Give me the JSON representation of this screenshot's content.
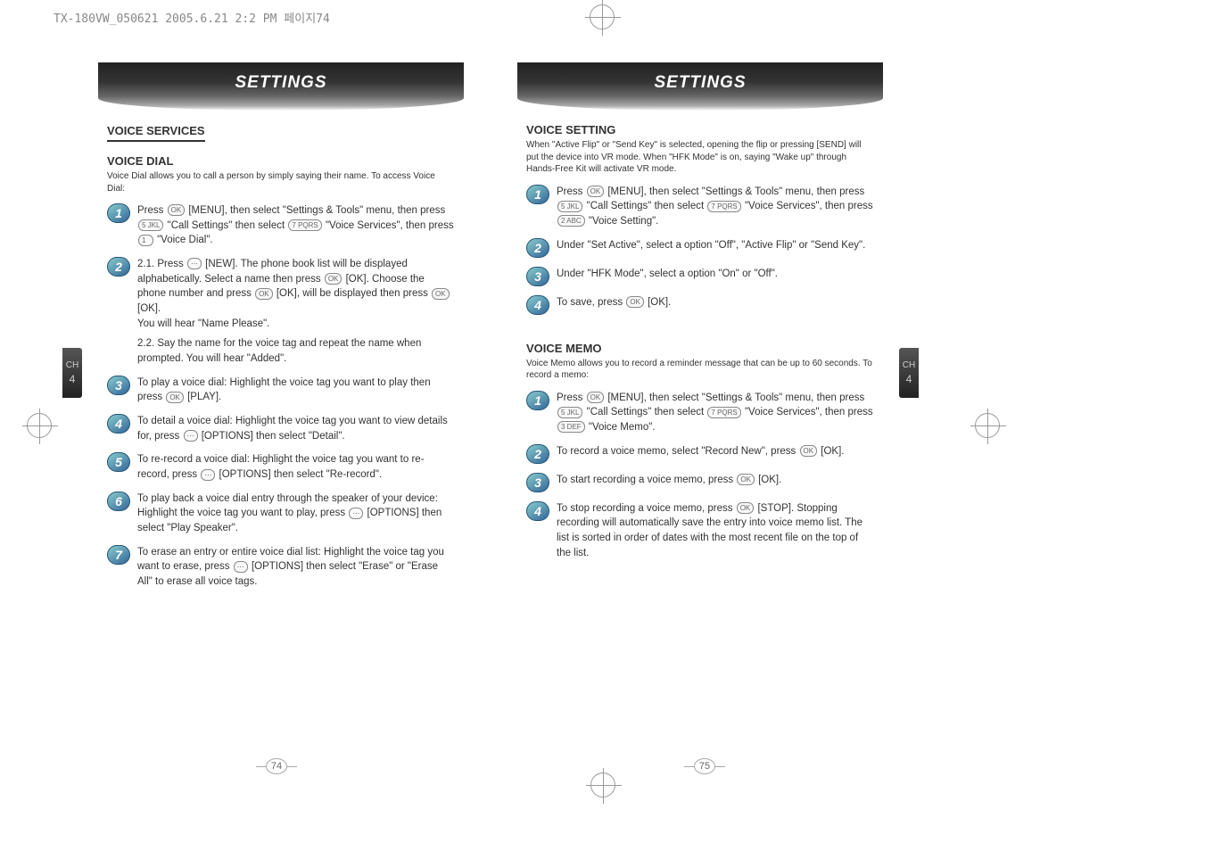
{
  "print_header": "TX-180VW_050621  2005.6.21 2:2 PM  페이지74",
  "left": {
    "banner": "SETTINGS",
    "section": "VOICE SERVICES",
    "sub": "VOICE DIAL",
    "intro": "Voice Dial allows you to call a person by simply saying their name. To access Voice Dial:",
    "steps": [
      {
        "n": "1",
        "text": "Press [OK] [MENU], then select \"Settings & Tools\" menu, then press [5] \"Call Settings\" then select [7] \"Voice Services\", then press [1] \"Voice Dial\"."
      },
      {
        "n": "2",
        "text": "2.1. Press [NEW]. The phone book list will be displayed alphabetically. Select a name then press [OK] [OK]. Choose the phone number and press [OK] [OK], will be displayed then press [OK] [OK].\nYou will hear \"Name Please\".\n2.2. Say the name for the voice tag and repeat the name when prompted. You will hear \"Added\"."
      },
      {
        "n": "3",
        "text": "To play a voice dial: Highlight the voice tag you want to play then press [OK] [PLAY]."
      },
      {
        "n": "4",
        "text": "To detail a voice dial: Highlight the voice tag you want to view details for, press [..] [OPTIONS] then select \"Detail\"."
      },
      {
        "n": "5",
        "text": "To re-record a voice dial: Highlight the voice tag you want to re-record, press [..] [OPTIONS] then select \"Re-record\"."
      },
      {
        "n": "6",
        "text": "To play back a voice dial entry through the speaker of your device:  Highlight the voice tag you want to play, press [..] [OPTIONS] then select \"Play Speaker\"."
      },
      {
        "n": "7",
        "text": "To erase an entry or entire voice dial list: Highlight the voice tag you want to erase, press [..] [OPTIONS] then select \"Erase\" or \"Erase All\" to erase all voice tags."
      }
    ],
    "tab": {
      "label": "CH",
      "num": "4"
    },
    "page_num": "74"
  },
  "right": {
    "banner": "SETTINGS",
    "sec1": {
      "heading": "VOICE SETTING",
      "intro": "When \"Active Flip\" or \"Send Key\" is selected, opening the flip or pressing [SEND] will put the device into VR mode.  When \"HFK Mode\" is on, saying \"Wake up\" through Hands-Free Kit will activate VR mode.",
      "steps": [
        {
          "n": "1",
          "text": "Press [OK] [MENU], then select \"Settings & Tools\" menu, then press [5] \"Call Settings\" then select [7] \"Voice Services\", then press [2] \"Voice Setting\"."
        },
        {
          "n": "2",
          "text": "Under \"Set Active\", select a option \"Off\", \"Active Flip\" or \"Send Key\"."
        },
        {
          "n": "3",
          "text": "Under \"HFK Mode\", select a option \"On\" or \"Off\"."
        },
        {
          "n": "4",
          "text": "To save, press [OK] [OK]."
        }
      ]
    },
    "sec2": {
      "heading": "VOICE MEMO",
      "intro": "Voice Memo allows you to record a reminder message that can be up to 60 seconds. To record a memo:",
      "steps": [
        {
          "n": "1",
          "text": "Press [OK] [MENU], then select \"Settings & Tools\" menu, then press [5] \"Call Settings\" then select [7] \"Voice Services\", then press [3] \"Voice Memo\"."
        },
        {
          "n": "2",
          "text": "To record a voice memo, select \"Record New\", press [OK] [OK]."
        },
        {
          "n": "3",
          "text": "To start recording a voice memo, press [OK] [OK]."
        },
        {
          "n": "4",
          "text": "To stop recording a voice memo, press [OK] [STOP]. Stopping recording will automatically save the entry into voice memo list.  The list is sorted in order of dates with the most recent file on the top of the list."
        }
      ]
    },
    "tab": {
      "label": "CH",
      "num": "4"
    },
    "page_num": "75"
  }
}
